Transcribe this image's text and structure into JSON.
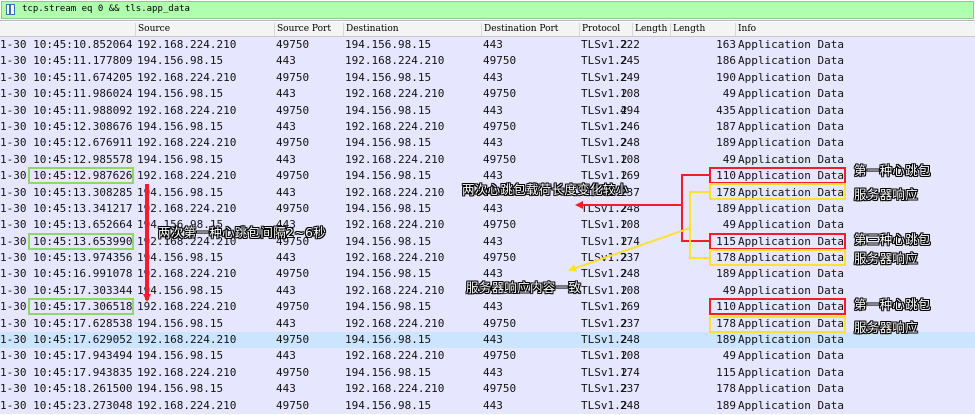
{
  "filter": {
    "text": "tcp.stream eq 0 && tls.app_data",
    "icon": "bookmark-icon"
  },
  "columns": [
    "Source",
    "Source Port",
    "Destination",
    "Destination Port",
    "Protocol",
    "Length",
    "Length",
    "Info"
  ],
  "rows": [
    {
      "time": "1-30 10:45:10.852064",
      "src": "192.168.224.210",
      "sport": "49750",
      "dst": "194.156.98.15",
      "dport": "443",
      "proto": "TLSv1.2",
      "len": "222",
      "len2": "163",
      "info": "Application Data"
    },
    {
      "time": "1-30 10:45:11.177809",
      "src": "194.156.98.15",
      "sport": "443",
      "dst": "192.168.224.210",
      "dport": "49750",
      "proto": "TLSv1.2",
      "len": "245",
      "len2": "186",
      "info": "Application Data"
    },
    {
      "time": "1-30 10:45:11.674205",
      "src": "192.168.224.210",
      "sport": "49750",
      "dst": "194.156.98.15",
      "dport": "443",
      "proto": "TLSv1.2",
      "len": "249",
      "len2": "190",
      "info": "Application Data"
    },
    {
      "time": "1-30 10:45:11.986024",
      "src": "194.156.98.15",
      "sport": "443",
      "dst": "192.168.224.210",
      "dport": "49750",
      "proto": "TLSv1.2",
      "len": "108",
      "len2": "49",
      "info": "Application Data"
    },
    {
      "time": "1-30 10:45:11.988092",
      "src": "192.168.224.210",
      "sport": "49750",
      "dst": "194.156.98.15",
      "dport": "443",
      "proto": "TLSv1.2",
      "len": "494",
      "len2": "435",
      "info": "Application Data"
    },
    {
      "time": "1-30 10:45:12.308676",
      "src": "194.156.98.15",
      "sport": "443",
      "dst": "192.168.224.210",
      "dport": "49750",
      "proto": "TLSv1.2",
      "len": "246",
      "len2": "187",
      "info": "Application Data"
    },
    {
      "time": "1-30 10:45:12.676911",
      "src": "192.168.224.210",
      "sport": "49750",
      "dst": "194.156.98.15",
      "dport": "443",
      "proto": "TLSv1.2",
      "len": "248",
      "len2": "189",
      "info": "Application Data"
    },
    {
      "time": "1-30 10:45:12.985578",
      "src": "194.156.98.15",
      "sport": "443",
      "dst": "192.168.224.210",
      "dport": "49750",
      "proto": "TLSv1.2",
      "len": "108",
      "len2": "49",
      "info": "Application Data"
    },
    {
      "time": "1-30 10:45:12.987626",
      "src": "192.168.224.210",
      "sport": "49750",
      "dst": "194.156.98.15",
      "dport": "443",
      "proto": "TLSv1.2",
      "len": "169",
      "len2": "110",
      "info": "Application Data"
    },
    {
      "time": "1-30 10:45:13.308285",
      "src": "194.156.98.15",
      "sport": "443",
      "dst": "192.168.224.210",
      "dport": "49750",
      "proto": "TLSv1.2",
      "len": "237",
      "len2": "178",
      "info": "Application Data"
    },
    {
      "time": "1-30 10:45:13.341217",
      "src": "192.168.224.210",
      "sport": "49750",
      "dst": "194.156.98.15",
      "dport": "443",
      "proto": "TLSv1.2",
      "len": "248",
      "len2": "189",
      "info": "Application Data"
    },
    {
      "time": "1-30 10:45:13.652664",
      "src": "194.156.98.15",
      "sport": "443",
      "dst": "192.168.224.210",
      "dport": "49750",
      "proto": "TLSv1.2",
      "len": "108",
      "len2": "49",
      "info": "Application Data"
    },
    {
      "time": "1-30 10:45:13.653990",
      "src": "192.168.224.210",
      "sport": "49750",
      "dst": "194.156.98.15",
      "dport": "443",
      "proto": "TLSv1.2",
      "len": "174",
      "len2": "115",
      "info": "Application Data"
    },
    {
      "time": "1-30 10:45:13.974356",
      "src": "194.156.98.15",
      "sport": "443",
      "dst": "192.168.224.210",
      "dport": "49750",
      "proto": "TLSv1.2",
      "len": "237",
      "len2": "178",
      "info": "Application Data"
    },
    {
      "time": "1-30 10:45:16.991078",
      "src": "192.168.224.210",
      "sport": "49750",
      "dst": "194.156.98.15",
      "dport": "443",
      "proto": "TLSv1.2",
      "len": "248",
      "len2": "189",
      "info": "Application Data"
    },
    {
      "time": "1-30 10:45:17.303344",
      "src": "194.156.98.15",
      "sport": "443",
      "dst": "192.168.224.210",
      "dport": "49750",
      "proto": "TLSv1.2",
      "len": "108",
      "len2": "49",
      "info": "Application Data"
    },
    {
      "time": "1-30 10:45:17.306518",
      "src": "192.168.224.210",
      "sport": "49750",
      "dst": "194.156.98.15",
      "dport": "443",
      "proto": "TLSv1.2",
      "len": "169",
      "len2": "110",
      "info": "Application Data"
    },
    {
      "time": "1-30 10:45:17.628538",
      "src": "194.156.98.15",
      "sport": "443",
      "dst": "192.168.224.210",
      "dport": "49750",
      "proto": "TLSv1.2",
      "len": "237",
      "len2": "178",
      "info": "Application Data"
    },
    {
      "time": "1-30 10:45:17.629052",
      "src": "192.168.224.210",
      "sport": "49750",
      "dst": "194.156.98.15",
      "dport": "443",
      "proto": "TLSv1.2",
      "len": "248",
      "len2": "189",
      "info": "Application Data",
      "selected": true
    },
    {
      "time": "1-30 10:45:17.943494",
      "src": "194.156.98.15",
      "sport": "443",
      "dst": "192.168.224.210",
      "dport": "49750",
      "proto": "TLSv1.2",
      "len": "108",
      "len2": "49",
      "info": "Application Data"
    },
    {
      "time": "1-30 10:45:17.943835",
      "src": "192.168.224.210",
      "sport": "49750",
      "dst": "194.156.98.15",
      "dport": "443",
      "proto": "TLSv1.2",
      "len": "174",
      "len2": "115",
      "info": "Application Data"
    },
    {
      "time": "1-30 10:45:18.261500",
      "src": "194.156.98.15",
      "sport": "443",
      "dst": "192.168.224.210",
      "dport": "49750",
      "proto": "TLSv1.2",
      "len": "237",
      "len2": "178",
      "info": "Application Data"
    },
    {
      "time": "1-30 10:45:23.273048",
      "src": "192.168.224.210",
      "sport": "49750",
      "dst": "194.156.98.15",
      "dport": "443",
      "proto": "TLSv1.2",
      "len": "248",
      "len2": "189",
      "info": "Application Data"
    }
  ],
  "annotations": {
    "heartbeat1_a": "第一种心跳包",
    "heartbeat1_b": "第一种心跳包",
    "heartbeat3": "第三种心跳包",
    "server_resp_a": "服务器响应",
    "server_resp_b": "服务器响应",
    "server_resp_c": "服务器响应",
    "payload_change": "两次心跳包载荷长度变化较小",
    "interval": "两次第一种心跳包间隔2~6秒",
    "resp_same": "服务器响应内容一致"
  },
  "colors": {
    "row_bg": "#e7e6ff",
    "row_selected_bg": "#cce5ff",
    "filter_bg": "#afffaf",
    "highlight_green": "#8ed86a",
    "highlight_red": "#ee1f2a",
    "highlight_yellow": "#ffe033"
  }
}
